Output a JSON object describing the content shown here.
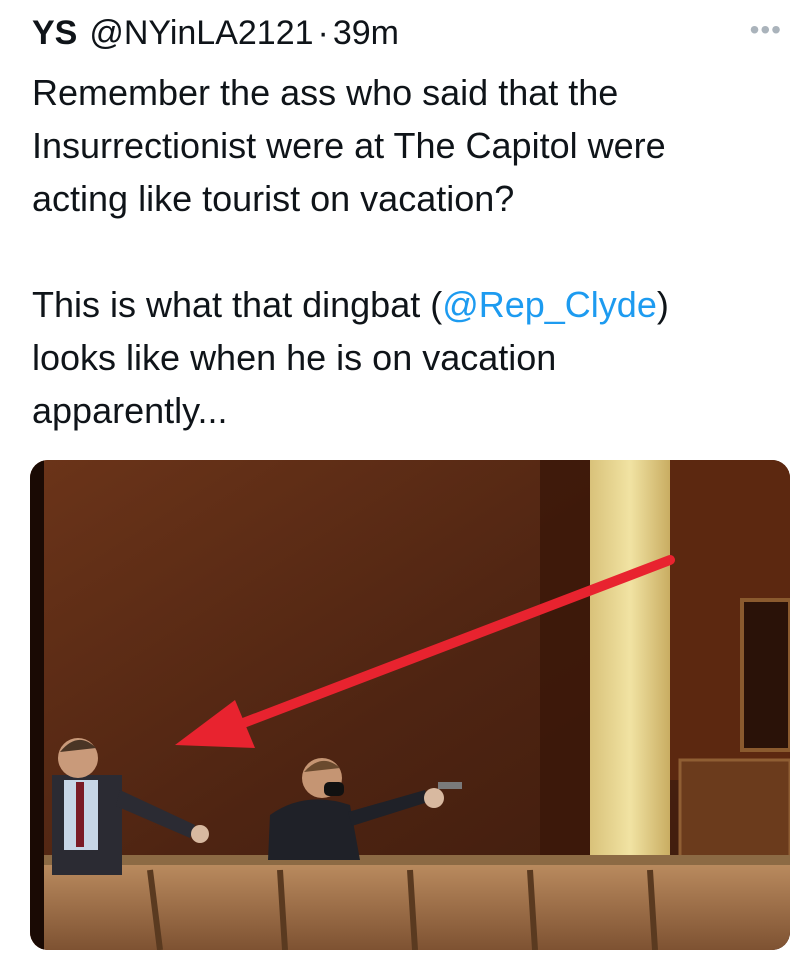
{
  "tweet": {
    "display_name": "YS",
    "handle": "@NYinLA2121",
    "separator": "·",
    "time": "39m",
    "more_icon": "more-icon",
    "text_line1": "Remember the ass who said that the",
    "text_line2": "Insurrectionist were at The Capitol were",
    "text_line3": "acting like tourist on vacation?",
    "text_p2_prefix": "This is what that dingbat (",
    "text_p2_mention": "@Rep_Clyde",
    "text_p2_suffix": ")",
    "text_p2_line2": "looks like when he is on vacation",
    "text_p2_line3": "apparently..."
  },
  "colors": {
    "mention": "#1d9bf0",
    "arrow": "#e8232f",
    "wall": "#5a2b16"
  },
  "media": {
    "kind": "photo",
    "icons": [
      "red-arrow-annotation"
    ]
  }
}
